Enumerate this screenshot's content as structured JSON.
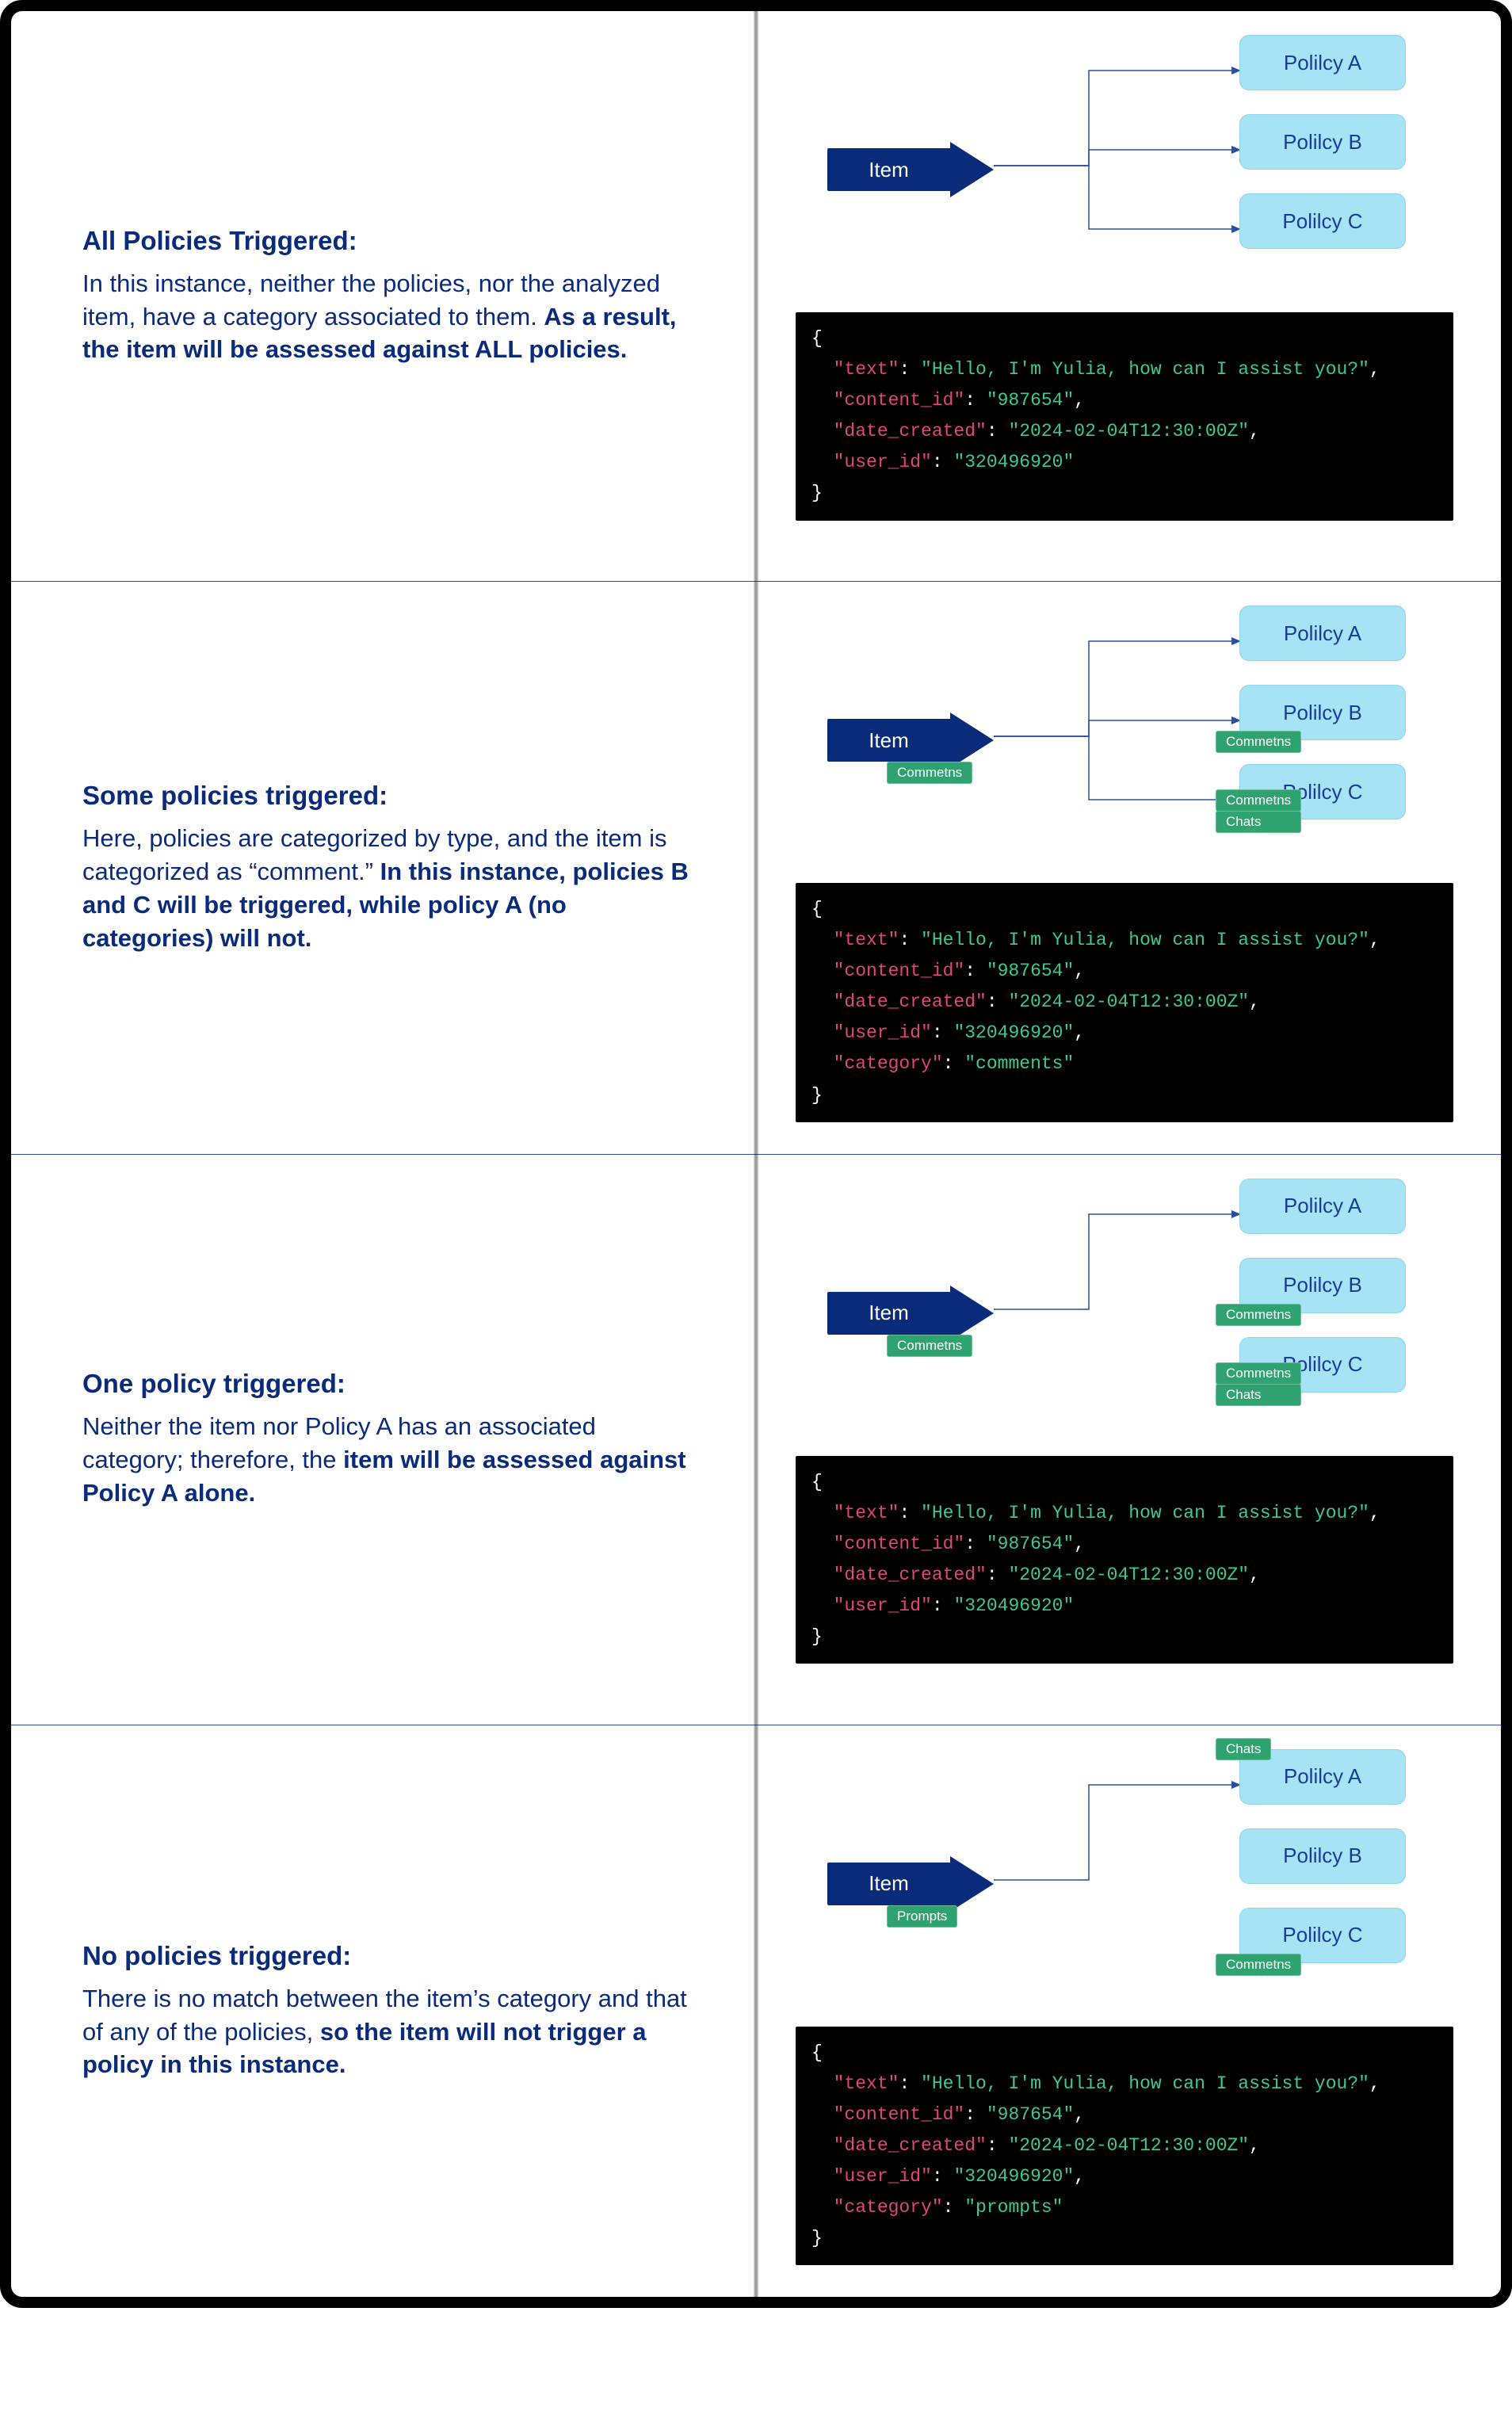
{
  "common": {
    "item_label": "Item",
    "policy_a": "Polilcy A",
    "policy_b": "Polilcy B",
    "policy_c": "Polilcy C",
    "tag_comments": "Commetns",
    "tag_chats": "Chats",
    "tag_prompts": "Prompts"
  },
  "sections": [
    {
      "title": "All Policies Triggered:",
      "desc_plain": "In this instance, neither the policies, nor the analyzed item, have a category associated to them.",
      "desc_bold": "As a result, the item will be assessed against ALL policies.",
      "item_tags": [],
      "policy_tags": {
        "a": [],
        "b": [],
        "c": []
      },
      "arrows_to": [
        "a",
        "b",
        "c"
      ],
      "code": {
        "text": "\"Hello, I'm Yulia, how can I assist you?\"",
        "content_id": "\"987654\"",
        "date_created": "\"2024-02-04T12:30:00Z\"",
        "user_id": "\"320496920\"",
        "category": null
      }
    },
    {
      "title": "Some policies triggered:",
      "desc_plain": "Here, policies are categorized by type, and the item is categorized as “comment.”",
      "desc_bold": "In this instance, policies B and C will be triggered, while policy A (no categories) will not.",
      "item_tags": [
        "Commetns"
      ],
      "policy_tags": {
        "a": [],
        "b": [
          "Commetns"
        ],
        "c": [
          "Commetns",
          "Chats"
        ]
      },
      "arrows_to": [
        "a",
        "b",
        "c"
      ],
      "code": {
        "text": "\"Hello, I'm Yulia, how can I assist you?\"",
        "content_id": "\"987654\"",
        "date_created": "\"2024-02-04T12:30:00Z\"",
        "user_id": "\"320496920\"",
        "category": "\"comments\""
      }
    },
    {
      "title": "One policy triggered:",
      "desc_pre": "Neither the item nor Policy A has an associated category; therefore, the ",
      "desc_bold": "item will be assessed against Policy A alone.",
      "item_tags": [
        "Commetns"
      ],
      "policy_tags": {
        "a": [],
        "b": [
          "Commetns"
        ],
        "c": [
          "Commetns",
          "Chats"
        ]
      },
      "arrows_to": [
        "a"
      ],
      "code": {
        "text": "\"Hello, I'm Yulia, how can I assist you?\"",
        "content_id": "\"987654\"",
        "date_created": "\"2024-02-04T12:30:00Z\"",
        "user_id": "\"320496920\"",
        "category": null
      }
    },
    {
      "title": "No policies triggered:",
      "desc_pre": "There is no match between the item’s category and that of any of the policies, ",
      "desc_bold": "so the item will not trigger a policy in this instance.",
      "item_tags": [
        "Prompts"
      ],
      "policy_tags": {
        "a": [
          "Chats"
        ],
        "b": [],
        "c": [
          "Commetns"
        ]
      },
      "policy_a_tag_pos": "top-left",
      "arrows_to": [
        "a"
      ],
      "code": {
        "text": "\"Hello, I'm Yulia, how can I assist you?\"",
        "content_id": "\"987654\"",
        "date_created": "\"2024-02-04T12:30:00Z\"",
        "user_id": "\"320496920\"",
        "category": "\"prompts\""
      }
    }
  ]
}
